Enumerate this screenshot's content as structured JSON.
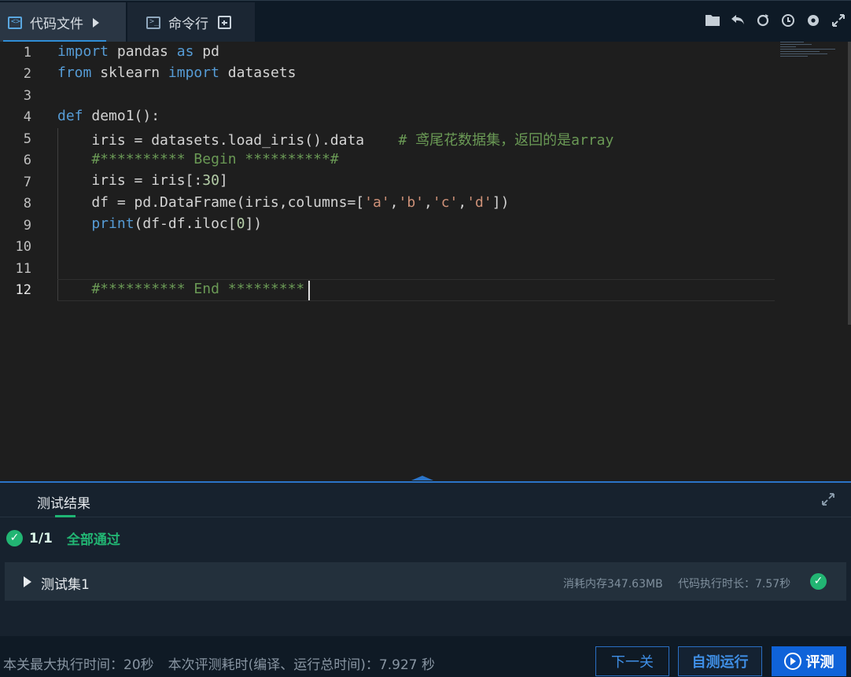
{
  "tabs": {
    "code": {
      "label": "代码文件"
    },
    "cmd": {
      "label": "命令行"
    }
  },
  "toolbar": {
    "icons": [
      "folder-icon",
      "undo-icon",
      "refresh-icon",
      "history-icon",
      "settings-icon",
      "fullscreen-icon"
    ]
  },
  "editor": {
    "line_numbers": [
      "1",
      "2",
      "3",
      "4",
      "5",
      "6",
      "7",
      "8",
      "9",
      "10",
      "11",
      "12"
    ],
    "active_line": "12",
    "code": {
      "l1": {
        "k1": "import",
        "t1": " pandas ",
        "k2": "as",
        "t2": " pd"
      },
      "l2": {
        "k1": "from",
        "t1": " sklearn ",
        "k2": "import",
        "t2": " datasets"
      },
      "l4": {
        "k1": "def",
        "t1": " demo1():"
      },
      "l5": {
        "t1": "    iris = datasets.load_iris().data    ",
        "c1": "# 鸢尾花数据集，返回的是array"
      },
      "l6": {
        "c1": "    #********** Begin **********#"
      },
      "l7": {
        "t1": "    iris = iris[:",
        "n1": "30",
        "t2": "]"
      },
      "l8": {
        "t1": "    df = pd.DataFrame(iris,columns=[",
        "s1": "'a'",
        "t2": ",",
        "s2": "'b'",
        "t3": ",",
        "s3": "'c'",
        "t4": ",",
        "s4": "'d'",
        "t5": "])"
      },
      "l9": {
        "k1": "    print",
        "t1": "(df-df.iloc[",
        "n1": "0",
        "t2": "])"
      },
      "l12": {
        "c1": "    #********** End *********"
      }
    }
  },
  "results": {
    "title": "测试结果",
    "summary": {
      "fraction": "1/1",
      "status": "全部通过"
    },
    "testset": {
      "name": "测试集1",
      "memory": "消耗内存347.63MB",
      "exec_time": "代码执行时长：7.57秒"
    }
  },
  "footer": {
    "max_time": "本关最大执行时间：20秒",
    "this_time": "本次评测耗时(编译、运行总时间)：7.927 秒",
    "next_label": "下一关",
    "selftest_label": "自测运行",
    "evaluate_label": "评测"
  },
  "colors": {
    "accent": "#0f63d9",
    "pass": "#22b573",
    "keyword": "#569cd6",
    "string": "#ce9178",
    "comment": "#6a9955",
    "number": "#b5cea8"
  }
}
